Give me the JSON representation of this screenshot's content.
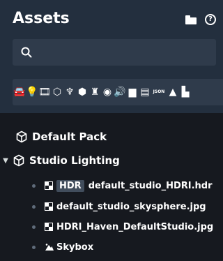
{
  "header": {
    "title": "Assets",
    "icons": [
      "folder-icon",
      "help-icon"
    ],
    "help_glyph": "?"
  },
  "search": {
    "placeholder": "",
    "value": "",
    "icon": "search-icon"
  },
  "filter_bar": {
    "icons": [
      "car-icon",
      "light-icon",
      "film-icon",
      "cube-icon",
      "rig-icon",
      "cube-add-icon",
      "character-icon",
      "circle-icon",
      "sound-icon",
      "document-icon",
      "comment-icon",
      "json-icon",
      "skybox-icon",
      "more-icon"
    ],
    "json_label": "JSON"
  },
  "tree": {
    "default_pack": {
      "label": "Default Pack",
      "icon": "cube-icon",
      "expanded": false
    },
    "studio_lighting": {
      "label": "Studio Lighting",
      "icon": "cube-icon",
      "expanded": true,
      "children": [
        {
          "badge": "HDR",
          "label": "default_studio_HDRI.hdr",
          "icon": "hdri-file-icon"
        },
        {
          "label": "default_studio_skysphere.jpg",
          "icon": "hdri-file-icon"
        },
        {
          "label": "HDRI_Haven_DefaultStudio.jpg",
          "icon": "hdri-file-icon"
        },
        {
          "label": "Skybox",
          "icon": "skybox-icon"
        }
      ]
    }
  },
  "colors": {
    "header_bg": "#232f3e",
    "panel_bg": "#16191f",
    "input_bg": "#2f3b4b",
    "text": "#ffffff",
    "bullet": "#5f6b7a"
  }
}
